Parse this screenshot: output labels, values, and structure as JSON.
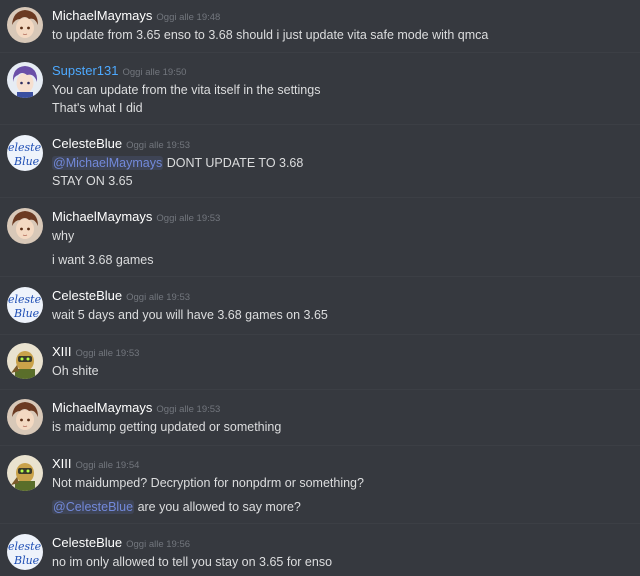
{
  "messages": [
    {
      "user": "MichaelMaymays",
      "time": "Oggi alle 19:48",
      "avatar": "brown-hair-anime-avatar",
      "lines": [
        {
          "text": "to update from 3.65 enso to 3.68 should i just update vita safe mode with qmca"
        }
      ]
    },
    {
      "user": "Supster131",
      "time": "Oggi alle 19:50",
      "avatar": "purple-hair-anime-avatar",
      "lines": [
        {
          "text": "You can update from the vita itself in the settings"
        },
        {
          "text": "That's what I did"
        }
      ]
    },
    {
      "user": "CelesteBlue",
      "time": "Oggi alle 19:53",
      "avatar": "celeste-blue-handwritten-avatar",
      "lines": [
        {
          "mention": "@MichaelMaymays",
          "text": " DONT UPDATE TO 3.68"
        },
        {
          "text": "STAY ON 3.65"
        }
      ]
    },
    {
      "user": "MichaelMaymays",
      "time": "Oggi alle 19:53",
      "avatar": "brown-hair-anime-avatar",
      "lines": [
        {
          "text": "why"
        },
        {
          "text": "i want 3.68 games"
        }
      ]
    },
    {
      "user": "CelesteBlue",
      "time": "Oggi alle 19:53",
      "avatar": "celeste-blue-handwritten-avatar",
      "lines": [
        {
          "text": "wait 5 days and you will have 3.68 games on 3.65"
        }
      ]
    },
    {
      "user": "XIII",
      "time": "Oggi alle 19:53",
      "avatar": "robot-character-avatar",
      "lines": [
        {
          "text": "Oh shite"
        }
      ]
    },
    {
      "user": "MichaelMaymays",
      "time": "Oggi alle 19:53",
      "avatar": "brown-hair-anime-avatar",
      "lines": [
        {
          "text": "is maidump getting updated or something"
        }
      ]
    },
    {
      "user": "XIII",
      "time": "Oggi alle 19:54",
      "avatar": "robot-character-avatar",
      "lines": [
        {
          "text": "Not maidumped? Decryption for nonpdrm or something?"
        },
        {
          "mention": "@CelesteBlue",
          "text": " are you allowed to say more?"
        }
      ]
    },
    {
      "user": "CelesteBlue",
      "time": "Oggi alle 19:56",
      "avatar": "celeste-blue-handwritten-avatar",
      "lines": [
        {
          "text": "no im only allowed to tell you stay on 3.65 for enso"
        }
      ]
    }
  ],
  "avatar_text": {
    "celeste": [
      "eleste",
      "Blue"
    ]
  },
  "colors": {
    "background": "#36393f",
    "username": "#ffffff",
    "username_blue": "#4da9ff",
    "text": "#dcddde",
    "timestamp": "#72767d",
    "mention": "#7289da"
  }
}
